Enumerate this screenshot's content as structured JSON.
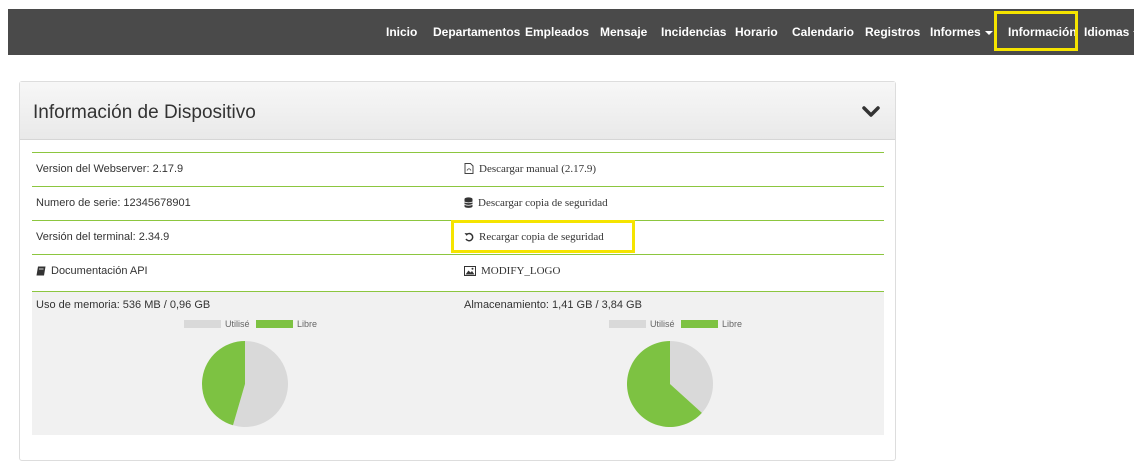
{
  "nav": {
    "items": [
      {
        "label": "Inicio"
      },
      {
        "label": "Departamentos"
      },
      {
        "label": "Empleados"
      },
      {
        "label": "Mensaje"
      },
      {
        "label": "Incidencias"
      },
      {
        "label": "Horario"
      },
      {
        "label": "Calendario"
      },
      {
        "label": "Registros"
      },
      {
        "label": "Informes"
      },
      {
        "label": "Información"
      },
      {
        "label": "Idiomas"
      }
    ],
    "active": "Información"
  },
  "panel": {
    "title": "Información de Dispositivo"
  },
  "rows": [
    {
      "left": "Version del Webserver: 2.17.9",
      "right": "Descargar manual (2.17.9)",
      "right_icon": "pdf-file-icon"
    },
    {
      "left": "Numero de serie: 12345678901",
      "right": "Descargar copia de seguridad",
      "right_icon": "database-icon"
    },
    {
      "left": "Versión del terminal: 2.34.9",
      "right": "Recargar copia de seguridad",
      "right_icon": "undo-icon"
    },
    {
      "left": "Documentación API",
      "left_icon": "book-icon",
      "right": "MODIFY_LOGO",
      "right_icon": "image-icon"
    }
  ],
  "memory": {
    "label": "Uso de memoria: 536 MB / 0,96 GB",
    "legend_used": "Utilisé",
    "legend_free": "Libre",
    "used_fraction": 0.545
  },
  "storage": {
    "label": "Almacenamiento: 1,41 GB / 3,84 GB",
    "legend_used": "Utilisé",
    "legend_free": "Libre",
    "used_fraction": 0.367
  },
  "colors": {
    "navbar": "#4a4a4a",
    "accent_green": "#7dc242",
    "used_gray": "#d9d9d9",
    "highlight": "#f5e400"
  }
}
